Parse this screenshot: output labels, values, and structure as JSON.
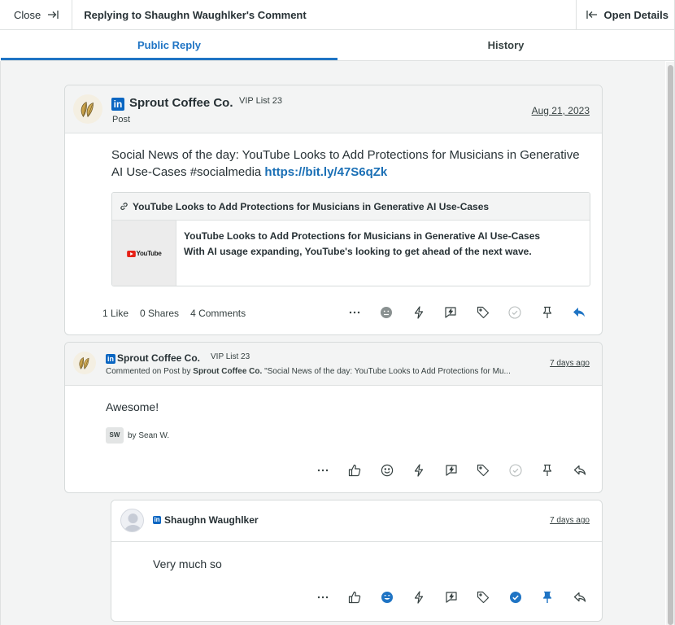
{
  "topbar": {
    "close_label": "Close",
    "title": "Replying to Shaughn Waughlker's Comment",
    "open_details_label": "Open Details"
  },
  "tabs": [
    {
      "label": "Public Reply",
      "active": true
    },
    {
      "label": "History",
      "active": false
    }
  ],
  "post": {
    "network_icon": "linkedin-icon",
    "author": "Sprout Coffee Co.",
    "vip": "VIP List 23",
    "type": "Post",
    "date": "Aug 21, 2023",
    "text": "Social News of the day: YouTube Looks to Add Protections for Musicians in Generative AI Use-Cases #socialmedia",
    "link": "https://bit.ly/47S6qZk",
    "preview": {
      "title": "YouTube Looks to Add Protections for Musicians in Generative AI Use-Cases",
      "headline": "YouTube Looks to Add Protections for Musicians in Generative AI Use-Cases",
      "description": "With AI usage expanding, YouTube's looking to get ahead of the next wave.",
      "thumb_label": "YouTube"
    },
    "stats": {
      "likes": "1 Like",
      "shares": "0 Shares",
      "comments": "4 Comments"
    }
  },
  "comment": {
    "author": "Sprout Coffee Co.",
    "vip": "VIP List 23",
    "context_prefix": "Commented on Post by",
    "context_author": "Sprout Coffee Co.",
    "context_quote": "\"Social News of the day: YouTube Looks to Add Protections for Mu...",
    "date": "7 days ago",
    "text": "Awesome!",
    "by_initials": "SW",
    "by_label": "by Sean W."
  },
  "reply": {
    "author": "Shaughn Waughlker",
    "date": "7 days ago",
    "text": "Very much so"
  },
  "colors": {
    "accent": "#1f74c4",
    "linkedin": "#0a66c2",
    "link_text": "#1a6fb5"
  }
}
